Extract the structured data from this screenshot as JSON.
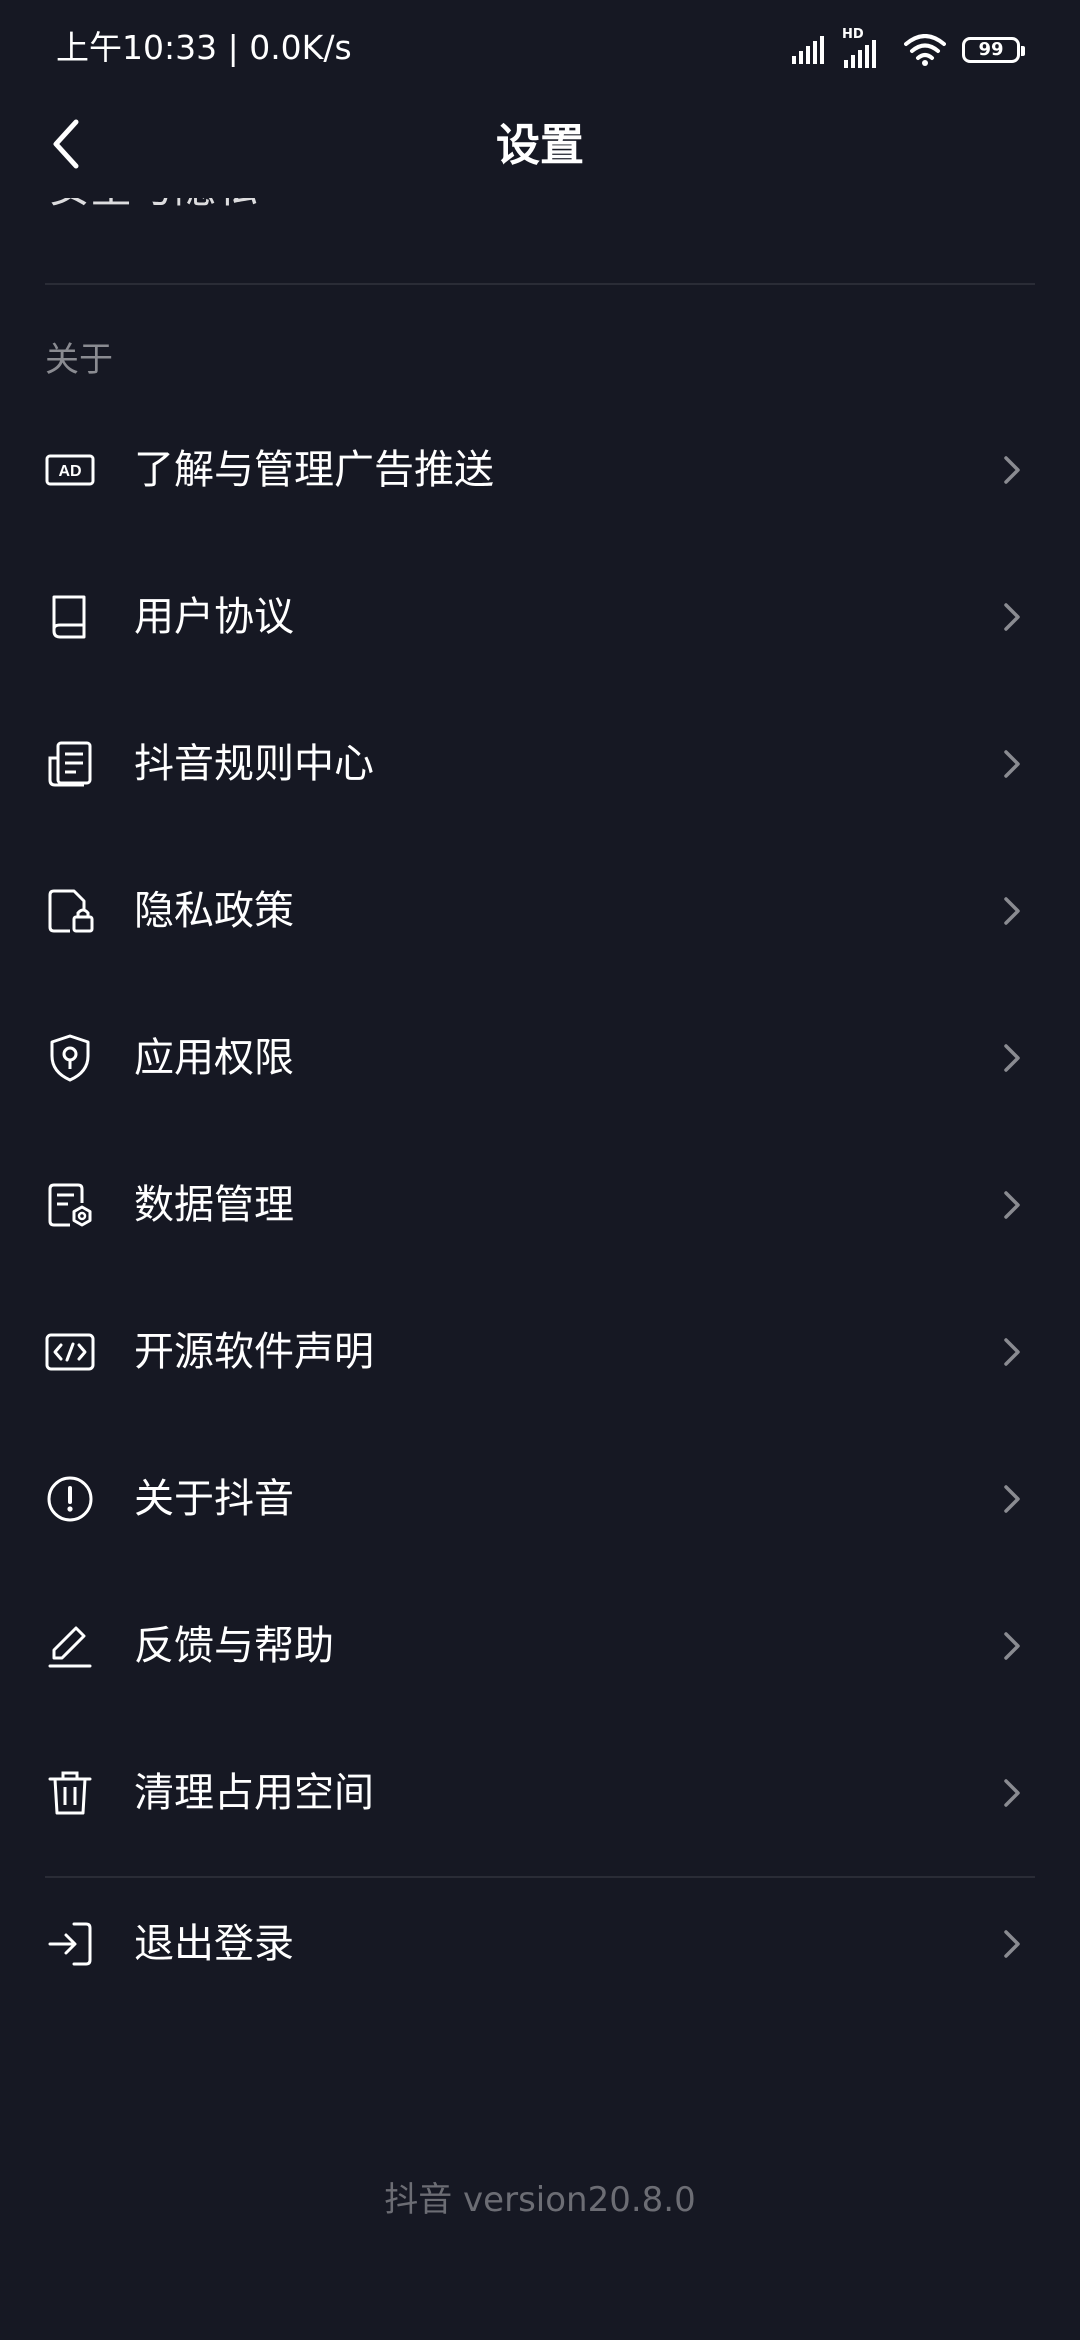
{
  "status_bar": {
    "time_speed": "上午10:33 | 0.0K/s",
    "network_badge": "HD",
    "battery": "99",
    "icons": [
      "signal-icon",
      "hd-signal-icon",
      "wifi-icon",
      "battery-icon"
    ]
  },
  "header": {
    "back_icon": "chevron-left-icon",
    "title": "设置"
  },
  "clipped_text": "安全与隐私",
  "section": {
    "title": "关于"
  },
  "menu_items": [
    {
      "label": "了解与管理广告推送",
      "icon": "ad-icon"
    },
    {
      "label": "用户协议",
      "icon": "book-icon"
    },
    {
      "label": "抖音规则中心",
      "icon": "rules-document-icon"
    },
    {
      "label": "隐私政策",
      "icon": "privacy-lock-icon"
    },
    {
      "label": "应用权限",
      "icon": "shield-key-icon"
    },
    {
      "label": "数据管理",
      "icon": "data-settings-icon"
    },
    {
      "label": "开源软件声明",
      "icon": "code-icon"
    },
    {
      "label": "关于抖音",
      "icon": "info-alert-icon"
    },
    {
      "label": "反馈与帮助",
      "icon": "pencil-icon"
    },
    {
      "label": "清理占用空间",
      "icon": "trash-icon"
    }
  ],
  "logout": {
    "label": "退出登录",
    "icon": "logout-icon"
  },
  "footer": {
    "version": "抖音 version20.8.0"
  },
  "colors": {
    "background": "#161823",
    "text_primary": "#ffffff",
    "text_secondary": "#8a8b91",
    "divider": "#2a2c36",
    "arrow": "#8a8b91",
    "version_text": "#6c6d74"
  }
}
